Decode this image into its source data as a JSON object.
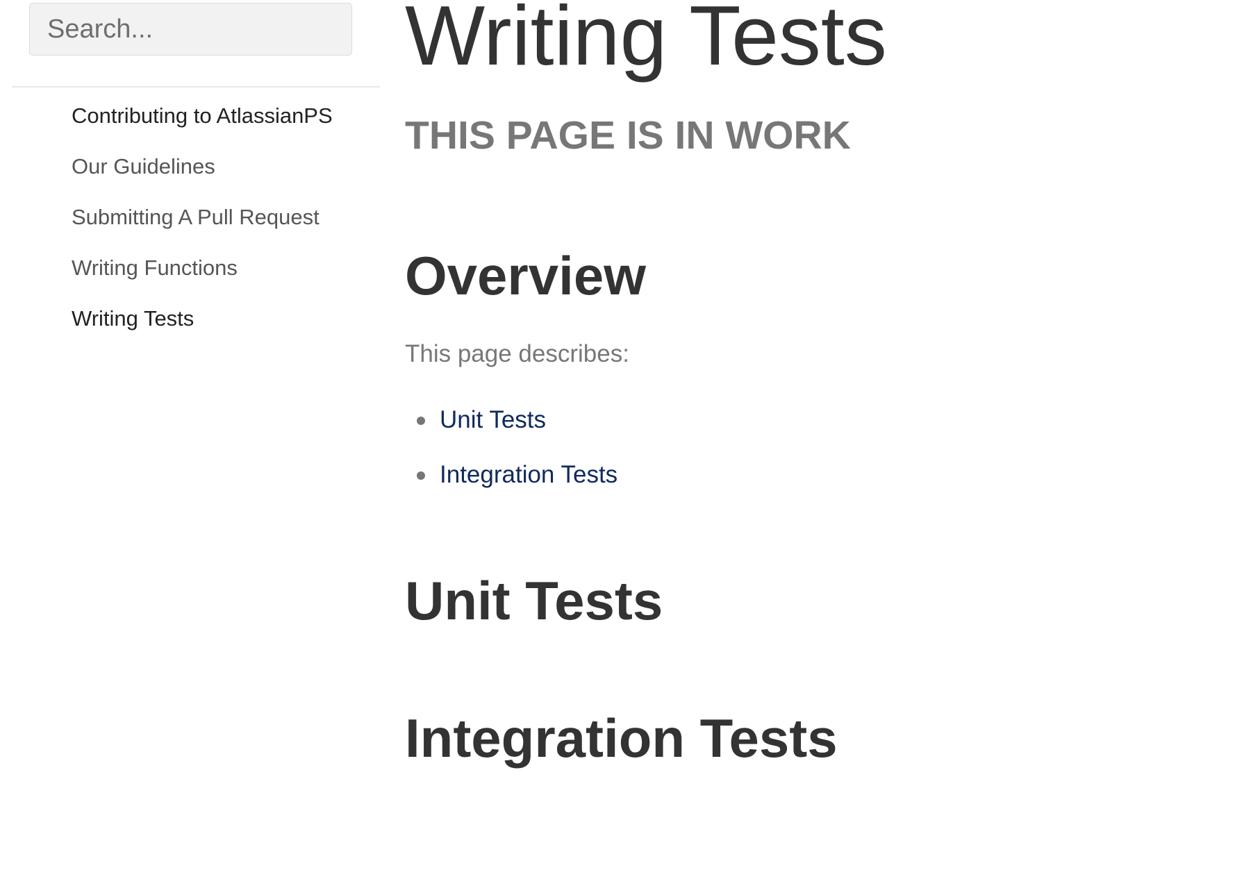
{
  "sidebar": {
    "search": {
      "placeholder": "Search...",
      "value": ""
    },
    "items": [
      {
        "label": "Contributing to AtlassianPS"
      },
      {
        "label": "Our Guidelines"
      },
      {
        "label": "Submitting A Pull Request"
      },
      {
        "label": "Writing Functions"
      },
      {
        "label": "Writing Tests",
        "active": true
      }
    ]
  },
  "main": {
    "title": "Writing Tests",
    "banner": "THIS PAGE IS IN WORK",
    "overview_heading": "Overview",
    "intro": "This page describes:",
    "toc": [
      {
        "label": "Unit Tests"
      },
      {
        "label": "Integration Tests"
      }
    ],
    "unit_tests_heading": "Unit Tests",
    "integration_tests_heading": "Integration Tests"
  },
  "colors": {
    "heading": "#333333",
    "muted": "#777777",
    "link": "#102a5c",
    "nav": "#555555",
    "nav_active": "#222222",
    "search_bg": "#f2f2f2"
  }
}
